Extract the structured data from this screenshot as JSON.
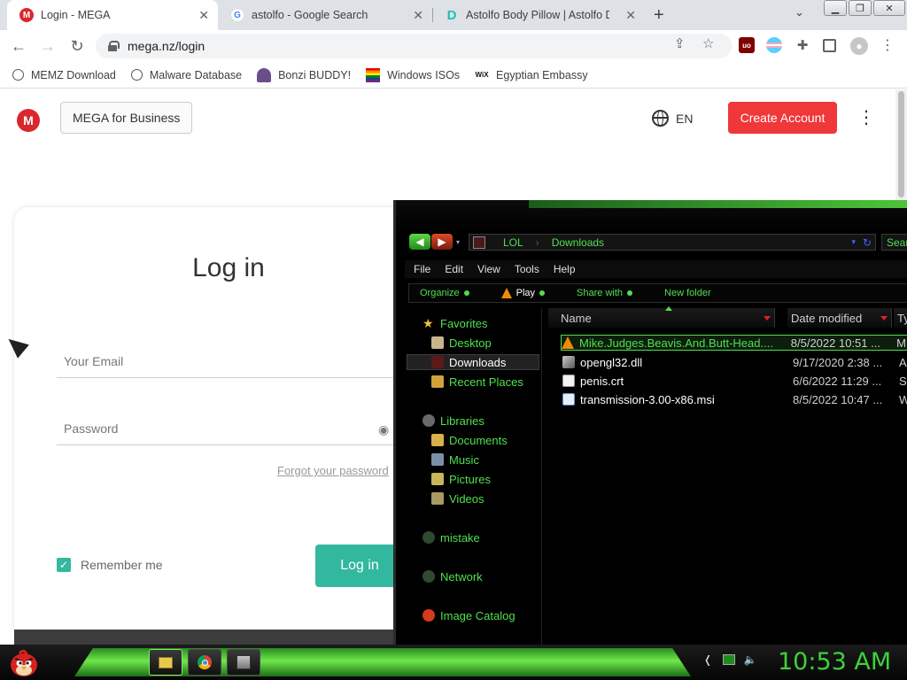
{
  "browser": {
    "tabs": [
      {
        "title": "Login - MEGA",
        "active": true
      },
      {
        "title": "astolfo - Google Search",
        "active": false
      },
      {
        "title": "Astolfo Body Pillow | Astolfo Dak",
        "active": false
      }
    ],
    "new_tab_label": "+",
    "url": "mega.nz/login",
    "bookmarks": [
      {
        "label": "MEMZ Download",
        "icon": "globe-icon"
      },
      {
        "label": "Malware Database",
        "icon": "globe-icon"
      },
      {
        "label": "Bonzi BUDDY!",
        "icon": "bonzi-icon"
      },
      {
        "label": "Windows ISOs",
        "icon": "windows-flag-icon"
      },
      {
        "label": "Egyptian Embassy",
        "icon": "wix-icon"
      }
    ]
  },
  "mega": {
    "logo_letter": "M",
    "business_button": "MEGA for Business",
    "language": "EN",
    "create_account": "Create Account",
    "login_title": "Log in",
    "email_placeholder": "Your Email",
    "password_placeholder": "Password",
    "forgot_password": "Forgot your password",
    "remember_me": "Remember me",
    "login_button": "Log in"
  },
  "explorer": {
    "breadcrumb": [
      "LOL",
      "Downloads"
    ],
    "search_placeholder": "Sear",
    "menu": [
      "File",
      "Edit",
      "View",
      "Tools",
      "Help"
    ],
    "commands": [
      "Organize",
      "Play",
      "Share with",
      "New folder"
    ],
    "nav": [
      {
        "label": "Favorites",
        "group": true
      },
      {
        "label": "Desktop"
      },
      {
        "label": "Downloads",
        "selected": true
      },
      {
        "label": "Recent Places"
      },
      {
        "label": "Libraries",
        "group": true
      },
      {
        "label": "Documents"
      },
      {
        "label": "Music"
      },
      {
        "label": "Pictures"
      },
      {
        "label": "Videos"
      },
      {
        "label": "mistake",
        "group": true
      },
      {
        "label": "Network",
        "group": true
      },
      {
        "label": "Image Catalog",
        "group": true
      }
    ],
    "columns": [
      "Name",
      "Date modified",
      "Ty"
    ],
    "files": [
      {
        "name": "Mike.Judges.Beavis.And.Butt-Head....",
        "date": "8/5/2022 10:51 ...",
        "type": "M",
        "selected": true,
        "icon": "vlc-icon"
      },
      {
        "name": "opengl32.dll",
        "date": "9/17/2020 2:38 ...",
        "type": "Ap",
        "icon": "dll-icon"
      },
      {
        "name": "penis.crt",
        "date": "6/6/2022 11:29 ...",
        "type": "Se",
        "icon": "certificate-icon"
      },
      {
        "name": "transmission-3.00-x86.msi",
        "date": "8/5/2022 10:47 ...",
        "type": "W",
        "icon": "installer-icon"
      }
    ]
  },
  "taskbar": {
    "clock": "10:53 AM"
  },
  "colors": {
    "mega_red": "#d9272e",
    "create_button": "#f0373a",
    "login_button": "#31b89e",
    "explorer_green": "#4fe04f",
    "clock_green": "#3bd23b"
  }
}
